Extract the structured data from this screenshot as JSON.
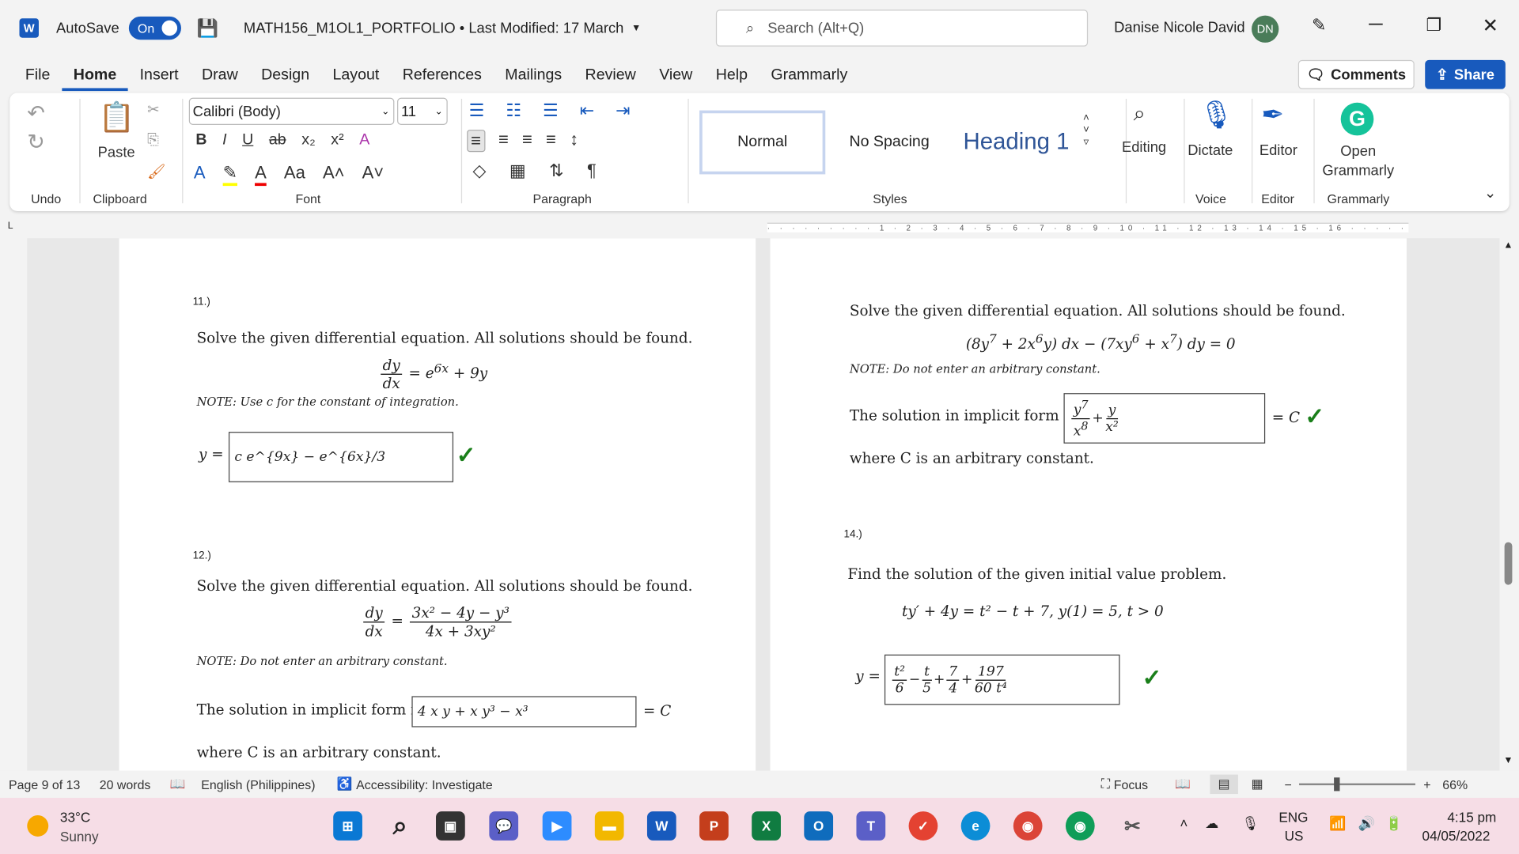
{
  "titlebar": {
    "autosave": "AutoSave",
    "toggle": "On",
    "doc_title": "MATH156_M1OL1_PORTFOLIO • Last Modified: 17 March",
    "search_placeholder": "Search (Alt+Q)",
    "user": "Danise Nicole David",
    "initials": "DN"
  },
  "tabs": [
    "File",
    "Home",
    "Insert",
    "Draw",
    "Design",
    "Layout",
    "References",
    "Mailings",
    "Review",
    "View",
    "Help",
    "Grammarly"
  ],
  "actions": {
    "comments": "Comments",
    "share": "Share"
  },
  "ribbon": {
    "groups": {
      "undo": "Undo",
      "clipboard": "Clipboard",
      "font": "Font",
      "paragraph": "Paragraph",
      "styles": "Styles",
      "voice": "Voice",
      "editor": "Editor",
      "grammarly": "Grammarly"
    },
    "paste": "Paste",
    "font_name": "Calibri (Body)",
    "font_size": "11",
    "styles": [
      "Normal",
      "No Spacing",
      "Heading 1"
    ],
    "editing": "Editing",
    "dictate": "Dictate",
    "editor": "Editor",
    "open_grammarly": "Open Grammarly"
  },
  "document": {
    "q11": {
      "num": "11.)",
      "prompt": "Solve the given differential equation. All solutions should be found.",
      "note": "NOTE: Use c for the constant of integration.",
      "answer": "c e^{9x} − e^{6x}/3"
    },
    "q12": {
      "num": "12.)",
      "prompt": "Solve the given differential equation. All solutions should be found.",
      "note": "NOTE: Do not enter an arbitrary constant.",
      "lead": "The solution in implicit form is",
      "answer": "4 x y + x y³ − x³",
      "tail": "= C",
      "where": "where C is an arbitrary constant."
    },
    "q13": {
      "prompt": "Solve the given differential equation. All solutions should be found.",
      "note": "NOTE: Do not enter an arbitrary constant.",
      "lead": "The solution in implicit form is",
      "tail": "= C",
      "where": "where C is an arbitrary constant."
    },
    "q14": {
      "num": "14.)",
      "prompt": "Find the solution of the given initial value problem.",
      "equation": "ty′ + 4y = t² − t + 7,  y(1) = 5,  t > 0"
    }
  },
  "status": {
    "page": "Page 9 of 13",
    "words": "20 words",
    "language": "English (Philippines)",
    "accessibility": "Accessibility: Investigate",
    "focus": "Focus",
    "zoom": "66%"
  },
  "taskbar": {
    "temp": "33°C",
    "weather": "Sunny",
    "lang1": "ENG",
    "lang2": "US",
    "time": "4:15 pm",
    "date": "04/05/2022"
  },
  "colors": {
    "accent": "#185abd",
    "check": "#1a7f1a",
    "taskbar": "#f6dde6"
  }
}
